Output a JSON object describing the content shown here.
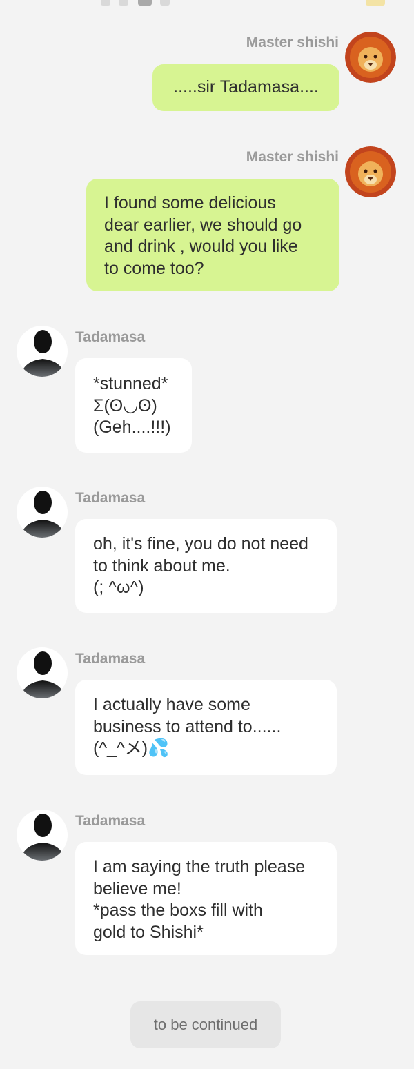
{
  "messages": [
    {
      "sender": "Master shishi",
      "side": "right",
      "avatar": "lion-icon",
      "text": ".....sir Tadamasa...."
    },
    {
      "sender": "Master shishi",
      "side": "right",
      "avatar": "lion-icon",
      "text": "I found some delicious\ndear earlier, we should go\nand drink , would you like\nto come too?"
    },
    {
      "sender": "Tadamasa",
      "side": "left",
      "avatar": "silhouette-icon",
      "text": "*stunned*\nΣ(ʘ◡ʘ)\n(Geh....!!!)"
    },
    {
      "sender": "Tadamasa",
      "side": "left",
      "avatar": "silhouette-icon",
      "text": "oh, it's fine, you do not need\nto think about me.\n(;  ^ω^)"
    },
    {
      "sender": "Tadamasa",
      "side": "left",
      "avatar": "silhouette-icon",
      "text": "I actually have some\nbusiness to attend to......\n(^_^メ)💦"
    },
    {
      "sender": "Tadamasa",
      "side": "left",
      "avatar": "silhouette-icon",
      "text": "I am saying the truth please\nbelieve me!\n *pass the boxs fill with\ngold to Shishi*"
    }
  ],
  "footer": {
    "label": "to be continued"
  },
  "colors": {
    "background": "#f3f3f3",
    "outgoing_bubble": "#d7f492",
    "incoming_bubble": "#ffffff",
    "sender_name": "#9a9a9a",
    "footer_pill": "#e6e6e6"
  }
}
